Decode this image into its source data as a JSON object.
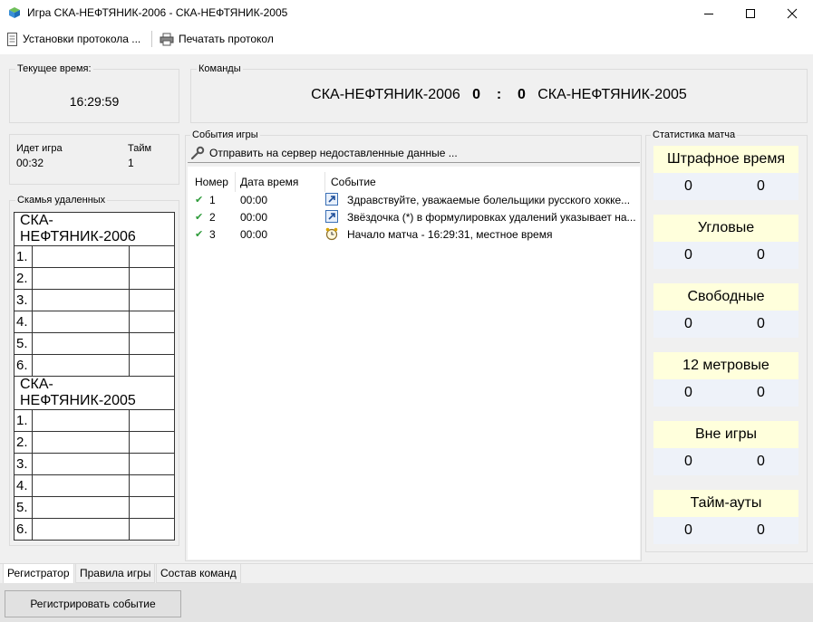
{
  "window": {
    "title": "Игра СКА-НЕФТЯНИК-2006 - СКА-НЕФТЯНИК-2005"
  },
  "toolbar": {
    "protocol_settings": "Установки протокола ...",
    "print_protocol": "Печатать протокол"
  },
  "current_time": {
    "label": "Текущее время:",
    "value": "16:29:59"
  },
  "teams": {
    "label": "Команды",
    "home": "СКА-НЕФТЯНИК-2006",
    "home_score": "0",
    "separator": ":",
    "away_score": "0",
    "away": "СКА-НЕФТЯНИК-2005"
  },
  "game_status": {
    "running_label": "Идет игра",
    "running_value": "00:32",
    "half_label": "Тайм",
    "half_value": "1"
  },
  "bench": {
    "label": "Скамья удаленных",
    "teams": [
      {
        "name": "СКА-НЕФТЯНИК-2006",
        "rows": [
          "1.",
          "2.",
          "3.",
          "4.",
          "5.",
          "6."
        ]
      },
      {
        "name": "СКА-НЕФТЯНИК-2005",
        "rows": [
          "1.",
          "2.",
          "3.",
          "4.",
          "5.",
          "6."
        ]
      }
    ]
  },
  "events": {
    "label": "События игры",
    "send_button": "Отправить на сервер недоставленные данные ...",
    "columns": [
      "Номер",
      "Дата время",
      "Событие"
    ],
    "rows": [
      {
        "num": "1",
        "time": "00:00",
        "icon": "arrow-icon",
        "text": "Здравствуйте, уважаемые болельщики русского хокке..."
      },
      {
        "num": "2",
        "time": "00:00",
        "icon": "arrow-icon",
        "text": "Звёздочка (*) в формулировках удалений указывает на..."
      },
      {
        "num": "3",
        "time": "00:00",
        "icon": "alarm-clock-icon",
        "text": "Начало матча - 16:29:31, местное время"
      }
    ]
  },
  "stats": {
    "label": "Статистика матча",
    "items": [
      {
        "title": "Штрафное время",
        "home": "0",
        "away": "0"
      },
      {
        "title": "Угловые",
        "home": "0",
        "away": "0"
      },
      {
        "title": "Свободные",
        "home": "0",
        "away": "0"
      },
      {
        "title": "12 метровые",
        "home": "0",
        "away": "0"
      },
      {
        "title": "Вне игры",
        "home": "0",
        "away": "0"
      },
      {
        "title": "Тайм-ауты",
        "home": "0",
        "away": "0"
      }
    ]
  },
  "tabs": [
    "Регистратор",
    "Правила игры",
    "Состав команд"
  ],
  "register_button": "Регистрировать событие",
  "colors": {
    "stat_title_bg": "#ffffdc",
    "stat_value_bg": "#eef2f9",
    "check_green": "#2e9b3a",
    "panel_bg": "#f0f0f0"
  }
}
